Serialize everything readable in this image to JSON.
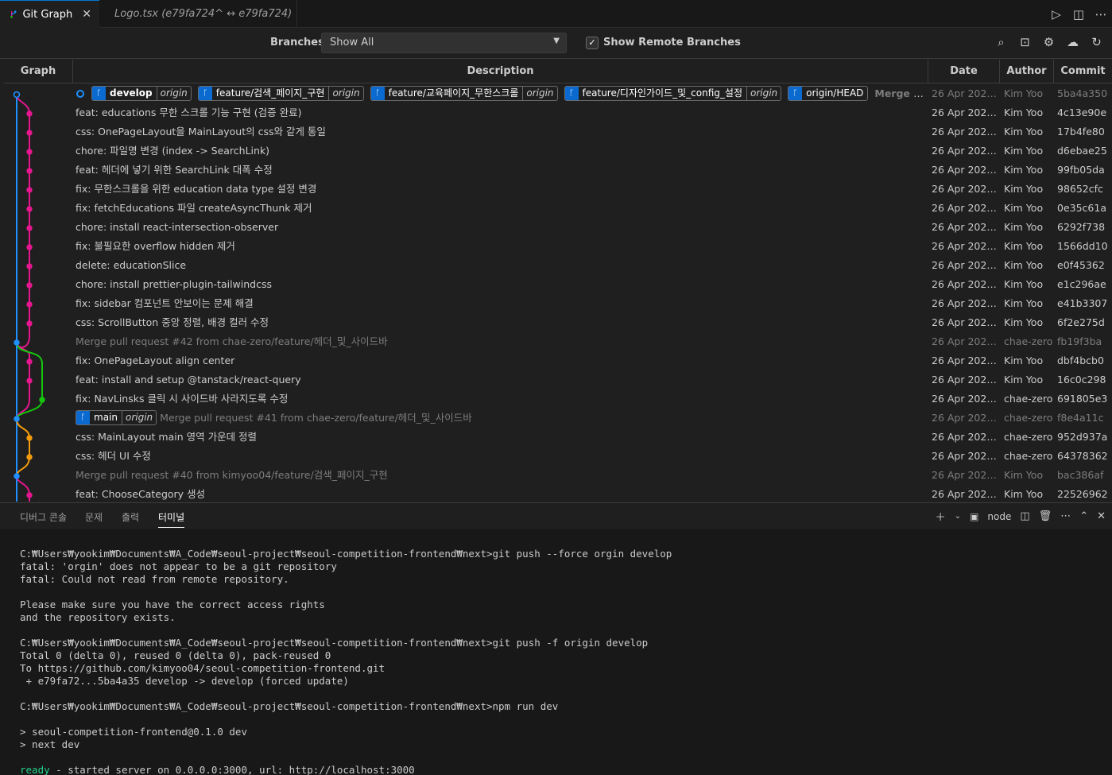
{
  "tabs": [
    {
      "label": "Git Graph",
      "icon": "git-graph-icon",
      "active": true
    },
    {
      "label": "Logo.tsx (e79fa724^ ↔ e79fa724)",
      "icon": "react-icon",
      "active": false
    }
  ],
  "controls": {
    "branches_label": "Branches:",
    "branches_value": "Show All",
    "remote_label": "Show Remote Branches",
    "remote_checked": true
  },
  "table": {
    "headers": {
      "graph": "Graph",
      "description": "Description",
      "date": "Date",
      "author": "Author",
      "commit": "Commit"
    },
    "first_row": {
      "refs": [
        {
          "name": "develop",
          "remote": "origin",
          "bold": true
        },
        {
          "name": "feature/검색_페이지_구현",
          "remote": "origin"
        },
        {
          "name": "feature/교육페이지_무한스크롤",
          "remote": "origin"
        },
        {
          "name": "feature/디자인가이드_및_config_설정",
          "remote": "origin"
        },
        {
          "name": "origin/HEAD"
        }
      ],
      "message": "Merge pull re...",
      "date": "26 Apr 2023 ...",
      "author": "Kim Yoo",
      "commit": "5ba4a350"
    },
    "rows": [
      {
        "desc": "feat: educations 무한 스크롤 기능 구현 (검증 완료)",
        "date": "26 Apr 2023 ...",
        "author": "Kim Yoo",
        "commit": "4c13e90e",
        "merge": false
      },
      {
        "desc": "css: OnePageLayout을 MainLayout의 css와 같게 통일",
        "date": "26 Apr 2023 ...",
        "author": "Kim Yoo",
        "commit": "17b4fe80",
        "merge": false
      },
      {
        "desc": "chore: 파일명 변경 (index -> SearchLink)",
        "date": "26 Apr 2023 ...",
        "author": "Kim Yoo",
        "commit": "d6ebae25",
        "merge": false
      },
      {
        "desc": "feat: 헤더에 넣기 위한 SearchLink 대폭 수정",
        "date": "26 Apr 2023 ...",
        "author": "Kim Yoo",
        "commit": "99fb05da",
        "merge": false
      },
      {
        "desc": "fix: 무한스크롤을 위한 education data type 설정 변경",
        "date": "26 Apr 2023 ...",
        "author": "Kim Yoo",
        "commit": "98652cfc",
        "merge": false
      },
      {
        "desc": "fix: fetchEducations 파일 createAsyncThunk 제거",
        "date": "26 Apr 2023 ...",
        "author": "Kim Yoo",
        "commit": "0e35c61a",
        "merge": false
      },
      {
        "desc": "chore: install react-intersection-observer",
        "date": "26 Apr 2023 ...",
        "author": "Kim Yoo",
        "commit": "6292f738",
        "merge": false
      },
      {
        "desc": "fix: 불필요한 overflow hidden 제거",
        "date": "26 Apr 2023 ...",
        "author": "Kim Yoo",
        "commit": "1566dd10",
        "merge": false
      },
      {
        "desc": "delete: educationSlice",
        "date": "26 Apr 2023 ...",
        "author": "Kim Yoo",
        "commit": "e0f45362",
        "merge": false
      },
      {
        "desc": "chore: install prettier-plugin-tailwindcss",
        "date": "26 Apr 2023 ...",
        "author": "Kim Yoo",
        "commit": "e1c296ae",
        "merge": false
      },
      {
        "desc": "fix: sidebar 컴포넌트 안보이는 문제 해결",
        "date": "26 Apr 2023 ...",
        "author": "Kim Yoo",
        "commit": "e41b3307",
        "merge": false
      },
      {
        "desc": "css: ScrollButton 중앙 정렬, 배경 컬러 수정",
        "date": "26 Apr 2023 ...",
        "author": "Kim Yoo",
        "commit": "6f2e275d",
        "merge": false
      },
      {
        "desc": "Merge pull request #42 from chae-zero/feature/헤더_및_사이드바",
        "date": "26 Apr 2023 ...",
        "author": "chae-zero",
        "commit": "fb19f3ba",
        "merge": true
      },
      {
        "desc": "fix: OnePageLayout align center",
        "date": "26 Apr 2023 ...",
        "author": "Kim Yoo",
        "commit": "dbf4bcb0",
        "merge": false
      },
      {
        "desc": "feat: install and setup @tanstack/react-query",
        "date": "26 Apr 2023 ...",
        "author": "Kim Yoo",
        "commit": "16c0c298",
        "merge": false
      },
      {
        "desc": "fix: NavLinsks 클릭 시 사이드바 사라지도록 수정",
        "date": "26 Apr 2023 ...",
        "author": "chae-zero",
        "commit": "691805e3",
        "merge": false
      },
      {
        "desc": "Merge pull request #41 from chae-zero/feature/헤더_및_사이드바",
        "date": "26 Apr 2023 ...",
        "author": "chae-zero",
        "commit": "f8e4a11c",
        "merge": true,
        "refs": [
          {
            "name": "main",
            "remote": "origin"
          }
        ]
      },
      {
        "desc": "css: MainLayout main 영역 가운데 정렬",
        "date": "26 Apr 2023 ...",
        "author": "chae-zero",
        "commit": "952d937a",
        "merge": false
      },
      {
        "desc": "css: 헤더 UI 수정",
        "date": "26 Apr 2023 ...",
        "author": "chae-zero",
        "commit": "64378362",
        "merge": false
      },
      {
        "desc": "Merge pull request #40 from kimyoo04/feature/검색_페이지_구현",
        "date": "26 Apr 2023 ...",
        "author": "Kim Yoo",
        "commit": "bac386af",
        "merge": true
      },
      {
        "desc": "feat: ChooseCategory 생성",
        "date": "26 Apr 2023 ...",
        "author": "Kim Yoo",
        "commit": "22526962",
        "merge": false
      }
    ]
  },
  "graph_colors": {
    "blue": "#1e90ff",
    "pink": "#e5168f",
    "green": "#16c60c",
    "orange": "#f29b0c"
  },
  "panel": {
    "tabs": [
      "디버그 콘솔",
      "문제",
      "출력",
      "터미널"
    ],
    "active_tab": "터미널",
    "terminal_label": "node"
  },
  "terminal": {
    "lines": [
      "C:₩Users₩yookim₩Documents₩A_Code₩seoul-project₩seoul-competition-frontend₩next>git push --force orgin develop",
      "fatal: 'orgin' does not appear to be a git repository",
      "fatal: Could not read from remote repository.",
      "",
      "Please make sure you have the correct access rights",
      "and the repository exists.",
      "",
      "C:₩Users₩yookim₩Documents₩A_Code₩seoul-project₩seoul-competition-frontend₩next>git push -f origin develop",
      "Total 0 (delta 0), reused 0 (delta 0), pack-reused 0",
      "To https://github.com/kimyoo04/seoul-competition-frontend.git",
      " + e79fa72...5ba4a35 develop -> develop (forced update)",
      "",
      "C:₩Users₩yookim₩Documents₩A_Code₩seoul-project₩seoul-competition-frontend₩next>npm run dev",
      "",
      "> seoul-competition-frontend@0.1.0 dev",
      "> next dev",
      ""
    ],
    "ready_word": "ready",
    "ready_rest": " - started server on 0.0.0.0:3000, url: http://localhost:3000"
  }
}
